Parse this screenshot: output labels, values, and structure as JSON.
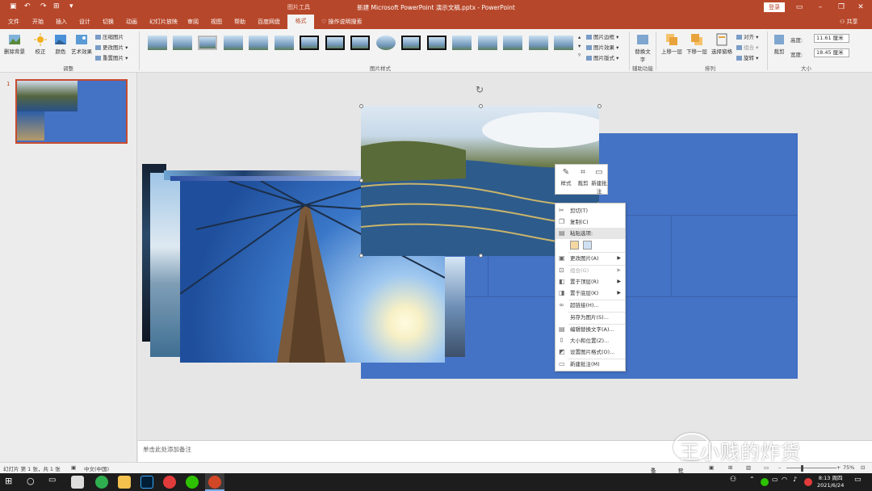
{
  "window": {
    "title": "新建 Microsoft PowerPoint 演示文稿.pptx  -  PowerPoint",
    "context_tool": "图片工具",
    "login": "登录"
  },
  "tabs": [
    "文件",
    "开始",
    "插入",
    "设计",
    "切换",
    "动画",
    "幻灯片放映",
    "审阅",
    "视图",
    "帮助",
    "百度网盘"
  ],
  "active_tab": "格式",
  "search_tab": "操作说明搜索",
  "share": "共享",
  "ribbon": {
    "remove_bg": "删除背景",
    "correct": "校正",
    "color": "颜色",
    "artistic": "艺术效果",
    "compress": "压缩图片",
    "change": "更改图片",
    "reset": "重置图片",
    "group_adjust": "调整",
    "group_styles": "图片样式",
    "border": "图片边框",
    "effects": "图片效果",
    "layout": "图片版式",
    "alt_text": "替换文字",
    "group_access": "辅助功能",
    "bring_forward": "上移一层",
    "send_backward": "下移一层",
    "selection_pane": "选择窗格",
    "align": "对齐",
    "group": "组合",
    "rotate": "旋转",
    "group_arrange": "排列",
    "crop": "裁剪",
    "height_label": "高度:",
    "height_value": "11.61 厘米",
    "width_label": "宽度:",
    "width_value": "18.45 厘米",
    "group_size": "大小"
  },
  "thumbnail_number": "1",
  "notes_placeholder": "单击此处添加备注",
  "mini_toolbar": {
    "style": "样式",
    "crop": "裁剪",
    "new_comment": "新建批注"
  },
  "context_menu": {
    "cut": "剪切(T)",
    "copy": "复制(C)",
    "paste_options": "粘贴选项:",
    "change_picture": "更改图片(A)",
    "group": "组合(G)",
    "bring_front": "置于顶层(R)",
    "send_back": "置于底层(K)",
    "link": "超链接(H)...",
    "save_as": "另存为图片(S)...",
    "alt_text": "编辑替换文字(A)...",
    "size_pos": "大小和位置(Z)...",
    "format": "设置图片格式(O)...",
    "new_comment": "新建批注(M)"
  },
  "status": {
    "slide": "幻灯片 第 1 张，共 1 张",
    "lang": "中文(中国)",
    "notes": "备注",
    "comments": "批注",
    "zoom": "75%"
  },
  "clock": {
    "time": "8:13 周四",
    "date": "2021/6/24"
  },
  "watermark": "王小贱的炸货",
  "colors": {
    "accent": "#b7472a",
    "slide_bg": "#4472c4"
  }
}
